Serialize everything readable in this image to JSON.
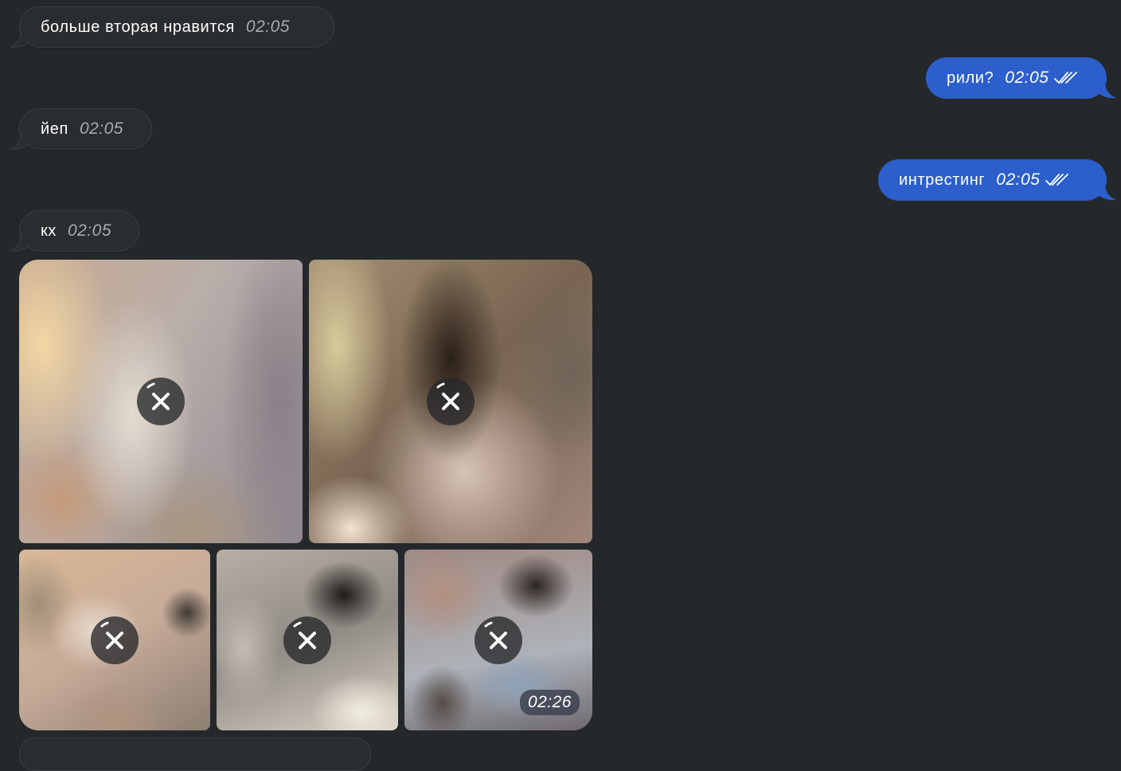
{
  "messages": [
    {
      "id": "m1",
      "direction": "incoming",
      "text": "больше вторая нравится",
      "time": "02:05"
    },
    {
      "id": "m2",
      "direction": "outgoing",
      "text": "рили?",
      "time": "02:05",
      "status": "read"
    },
    {
      "id": "m3",
      "direction": "incoming",
      "text": "йеп",
      "time": "02:05"
    },
    {
      "id": "m4",
      "direction": "outgoing",
      "text": "интрестинг",
      "time": "02:05",
      "status": "read"
    },
    {
      "id": "m5",
      "direction": "incoming",
      "text": "кх",
      "time": "02:05"
    }
  ],
  "media_album": {
    "direction": "incoming",
    "items": [
      {
        "kind": "photo",
        "state": "downloading",
        "action_icon": "close-icon"
      },
      {
        "kind": "photo",
        "state": "downloading",
        "action_icon": "close-icon"
      },
      {
        "kind": "photo",
        "state": "downloading",
        "action_icon": "close-icon"
      },
      {
        "kind": "photo",
        "state": "downloading",
        "action_icon": "close-icon"
      },
      {
        "kind": "photo",
        "state": "downloading",
        "action_icon": "close-icon"
      }
    ],
    "time": "02:26"
  },
  "colors": {
    "background": "#25282b",
    "incoming_bubble": "#2a2d30",
    "outgoing_bubble": "#2c5fcc",
    "timestamp_incoming": "#a7aaae"
  }
}
